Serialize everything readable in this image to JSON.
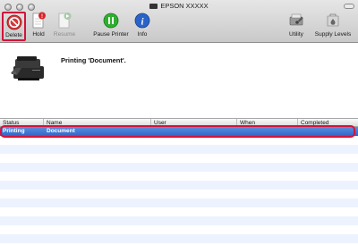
{
  "window": {
    "title": "EPSON XXXXX"
  },
  "toolbar": {
    "delete_label": "Delete",
    "hold_label": "Hold",
    "resume_label": "Resume",
    "pause_label": "Pause Printer",
    "info_label": "Info",
    "utility_label": "Utility",
    "supply_label": "Supply Levels",
    "hold_badge": "!"
  },
  "status": {
    "message": "Printing 'Document'."
  },
  "table": {
    "columns": [
      "Status",
      "Name",
      "User",
      "When",
      "Completed"
    ],
    "rows": [
      {
        "status": "Printing",
        "name": "Document",
        "user": "",
        "when": "",
        "completed": ""
      }
    ]
  },
  "icons": {
    "delete": "delete-icon",
    "hold": "hold-icon",
    "resume": "resume-icon",
    "pause": "pause-icon",
    "info": "info-icon",
    "utility": "utility-icon",
    "supply": "supply-levels-icon",
    "printer": "printer-icon"
  },
  "colors": {
    "highlight": "#d2143a",
    "selection": "#3a70d0",
    "pause_green": "#2fae2f",
    "info_blue": "#2a63c8",
    "stripe": "#edf3fe"
  }
}
